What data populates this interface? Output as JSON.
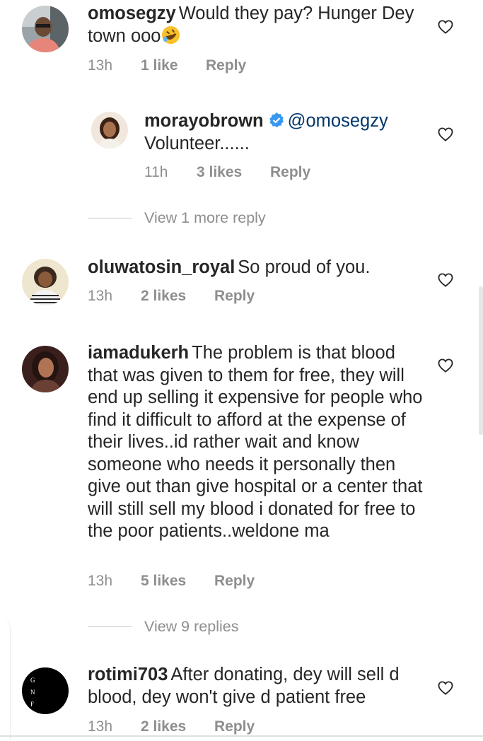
{
  "comments": [
    {
      "username": "omosegzy",
      "text": "Would they pay? Hunger Dey town ooo",
      "time": "13h",
      "likes": "1 like",
      "reply_label": "Reply",
      "emoji": "rolling-on-floor-laughing-emoji"
    },
    {
      "username": "morayobrown",
      "verified": true,
      "mention": "@omosegzy",
      "text": "Volunteer......",
      "time": "11h",
      "likes": "3 likes",
      "reply_label": "Reply",
      "view_more": "View 1 more reply"
    },
    {
      "username": "oluwatosin_royal",
      "text": "So proud of you.",
      "time": "13h",
      "likes": "2 likes",
      "reply_label": "Reply"
    },
    {
      "username": "iamadukerh",
      "text": "The problem is that blood that was given to them for free, they will end up selling it expensive for people who find it difficult to afford at the expense of their lives..id rather wait and know someone who needs it personally then give out than give hospital or a center that will still sell my blood i donated for free to the poor patients..weldone ma",
      "time": "13h",
      "likes": "5 likes",
      "reply_label": "Reply",
      "view_more": "View 9 replies"
    },
    {
      "username": "rotimi703",
      "text": "After donating, dey will sell d blood, dey won't give d patient free",
      "time": "13h",
      "likes": "2 likes",
      "reply_label": "Reply",
      "avatar_text": [
        "G",
        "N",
        "F"
      ]
    }
  ],
  "colors": {
    "text": "#262626",
    "secondary": "#8e8e8e",
    "verified_blue": "#3897f0",
    "mention": "#00376b"
  }
}
